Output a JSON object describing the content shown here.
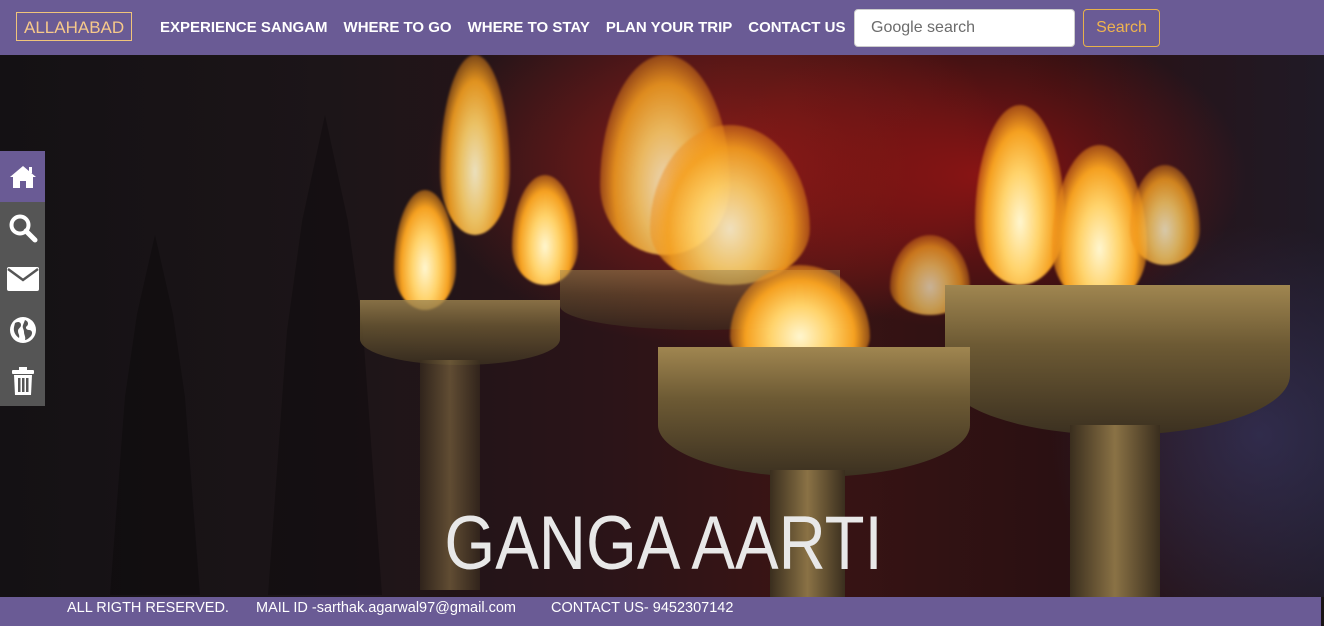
{
  "brand": "ALLAHABAD",
  "nav": [
    "EXPERIENCE SANGAM",
    "WHERE TO GO",
    "WHERE TO STAY",
    "PLAN YOUR TRIP",
    "CONTACT US"
  ],
  "search": {
    "placeholder": "Google search",
    "button_label": "Search"
  },
  "sidebar": [
    {
      "icon": "home-icon"
    },
    {
      "icon": "search-icon"
    },
    {
      "icon": "mail-icon"
    },
    {
      "icon": "globe-icon"
    },
    {
      "icon": "trash-icon"
    }
  ],
  "hero": {
    "title": "GANGA AARTI"
  },
  "footer": {
    "rights": "ALL RIGTH RESERVED.",
    "mail": "MAIL ID -sarthak.agarwal97@gmail.com",
    "contact": "CONTACT US- 9452307142"
  },
  "colors": {
    "nav_bg": "#6a5b95",
    "brand": "#f7c98a",
    "search_btn": "#f0b44e",
    "sidebar_bg": "#555555"
  }
}
